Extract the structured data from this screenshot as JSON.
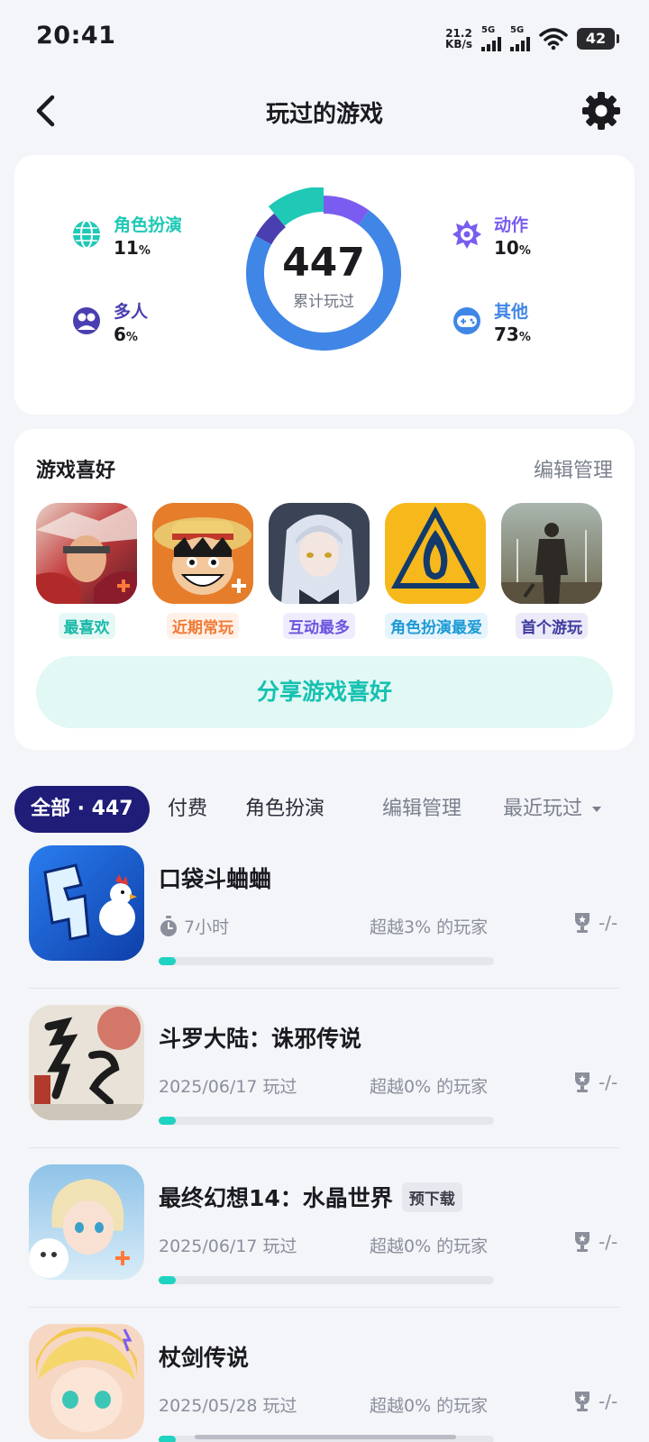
{
  "status_bar": {
    "time": "20:41",
    "net_speed_value": "21.2",
    "net_speed_unit": "KB/s",
    "sim1": "5G",
    "sim2": "5G",
    "battery": "42"
  },
  "header": {
    "title": "玩过的游戏"
  },
  "stats": {
    "total": "447",
    "total_caption": "累计玩过",
    "categories": [
      {
        "name": "角色扮演",
        "pct": "11",
        "color": "#1fc9b6",
        "icon": "globe-icon"
      },
      {
        "name": "动作",
        "pct": "10",
        "color": "#7a5cf0",
        "icon": "action-burst-icon"
      },
      {
        "name": "多人",
        "pct": "6",
        "color": "#4a3fb0",
        "icon": "multiplayer-icon"
      },
      {
        "name": "其他",
        "pct": "73",
        "color": "#3f86e6",
        "icon": "gamepad-icon"
      }
    ],
    "pct_unit": "%"
  },
  "prefs": {
    "title": "游戏喜好",
    "edit": "编辑管理",
    "items": [
      {
        "tag": "最喜欢",
        "tag_color": "#18b9a8",
        "tag_bg": "#e6f8f5"
      },
      {
        "tag": "近期常玩",
        "tag_color": "#f07a35",
        "tag_bg": "#fff1e8"
      },
      {
        "tag": "互动最多",
        "tag_color": "#6b53e0",
        "tag_bg": "#efecfd"
      },
      {
        "tag": "角色扮演最爱",
        "tag_color": "#1c9ad6",
        "tag_bg": "#e7f4fc"
      },
      {
        "tag": "首个游玩",
        "tag_color": "#3d3a9e",
        "tag_bg": "#eceaf8"
      }
    ],
    "share": "分享游戏喜好"
  },
  "filters": {
    "all": "全部 · 447",
    "paid": "付费",
    "rpg": "角色扮演",
    "edit": "编辑管理",
    "sort": "最近玩过"
  },
  "games": [
    {
      "name": "口袋斗蛐蛐",
      "meta": "7小时",
      "rank": "超越3% 的玩家",
      "trophy": "-/-",
      "badge": "",
      "progress": 0.05
    },
    {
      "name": "斗罗大陆：诛邪传说",
      "meta": "2025/06/17 玩过",
      "rank": "超越0% 的玩家",
      "trophy": "-/-",
      "badge": "",
      "progress": 0.05
    },
    {
      "name": "最终幻想14：水晶世界",
      "meta": "2025/06/17 玩过",
      "rank": "超越0% 的玩家",
      "trophy": "-/-",
      "badge": "预下载",
      "progress": 0.05
    },
    {
      "name": "杖剑传说",
      "meta": "2025/05/28 玩过",
      "rank": "超越0% 的玩家",
      "trophy": "-/-",
      "badge": "",
      "progress": 0.05
    }
  ]
}
